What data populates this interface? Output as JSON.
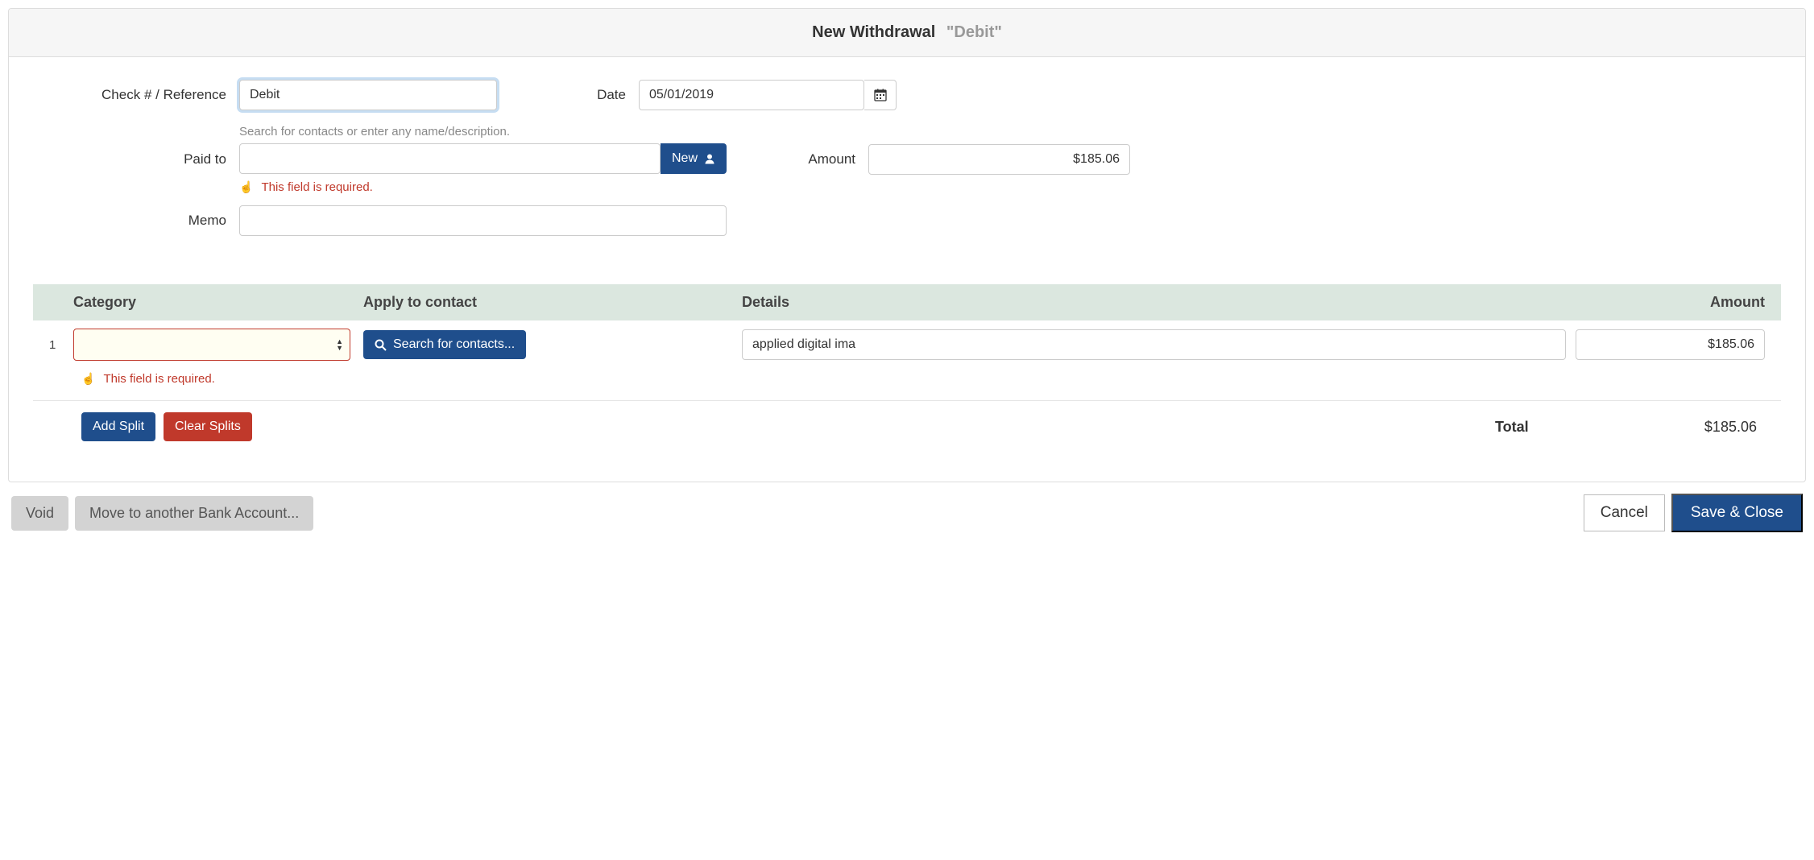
{
  "header": {
    "title": "New Withdrawal",
    "subtitle": "\"Debit\""
  },
  "form": {
    "reference_label": "Check # / Reference",
    "reference_value": "Debit",
    "date_label": "Date",
    "date_value": "05/01/2019",
    "paidto_label": "Paid to",
    "paidto_hint": "Search for contacts or enter any name/description.",
    "paidto_value": "",
    "paidto_error": "This field is required.",
    "new_btn": "New",
    "amount_label": "Amount",
    "amount_value": "$185.06",
    "memo_label": "Memo",
    "memo_value": ""
  },
  "splits": {
    "headers": {
      "category": "Category",
      "apply": "Apply to contact",
      "details": "Details",
      "amount": "Amount"
    },
    "rows": [
      {
        "index": "1",
        "category": "",
        "apply_btn": "Search for contacts...",
        "details": "applied digital ima",
        "amount": "$185.06",
        "error": "This field is required."
      }
    ],
    "add_split": "Add Split",
    "clear_splits": "Clear Splits",
    "total_label": "Total",
    "total_value": "$185.06"
  },
  "footer": {
    "void": "Void",
    "move": "Move to another Bank Account...",
    "cancel": "Cancel",
    "save": "Save & Close"
  }
}
